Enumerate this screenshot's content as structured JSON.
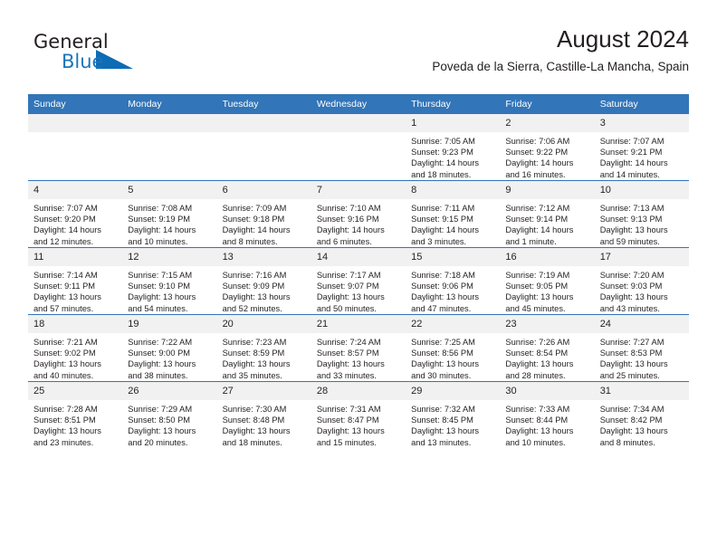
{
  "brand": {
    "name_part1": "General",
    "name_part2": "Blue",
    "triangle_color": "#0d6cb4"
  },
  "header": {
    "title": "August 2024",
    "subtitle": "Poveda de la Sierra, Castille-La Mancha, Spain"
  },
  "theme": {
    "header_blue": "#3275b8",
    "daynum_gray": "#f1f1f1",
    "text": "#231f20",
    "brand_blue": "#1b75bb"
  },
  "weekdays": [
    "Sunday",
    "Monday",
    "Tuesday",
    "Wednesday",
    "Thursday",
    "Friday",
    "Saturday"
  ],
  "labels": {
    "sunrise_prefix": "Sunrise:",
    "sunset_prefix": "Sunset:",
    "daylight_prefix": "Daylight:"
  },
  "weeks": [
    [
      {
        "day": "",
        "empty": true
      },
      {
        "day": "",
        "empty": true
      },
      {
        "day": "",
        "empty": true
      },
      {
        "day": "",
        "empty": true
      },
      {
        "day": "1",
        "sunrise": "Sunrise: 7:05 AM",
        "sunset": "Sunset: 9:23 PM",
        "daylight_line1": "Daylight: 14 hours",
        "daylight_line2": "and 18 minutes."
      },
      {
        "day": "2",
        "sunrise": "Sunrise: 7:06 AM",
        "sunset": "Sunset: 9:22 PM",
        "daylight_line1": "Daylight: 14 hours",
        "daylight_line2": "and 16 minutes."
      },
      {
        "day": "3",
        "sunrise": "Sunrise: 7:07 AM",
        "sunset": "Sunset: 9:21 PM",
        "daylight_line1": "Daylight: 14 hours",
        "daylight_line2": "and 14 minutes."
      }
    ],
    [
      {
        "day": "4",
        "sunrise": "Sunrise: 7:07 AM",
        "sunset": "Sunset: 9:20 PM",
        "daylight_line1": "Daylight: 14 hours",
        "daylight_line2": "and 12 minutes."
      },
      {
        "day": "5",
        "sunrise": "Sunrise: 7:08 AM",
        "sunset": "Sunset: 9:19 PM",
        "daylight_line1": "Daylight: 14 hours",
        "daylight_line2": "and 10 minutes."
      },
      {
        "day": "6",
        "sunrise": "Sunrise: 7:09 AM",
        "sunset": "Sunset: 9:18 PM",
        "daylight_line1": "Daylight: 14 hours",
        "daylight_line2": "and 8 minutes."
      },
      {
        "day": "7",
        "sunrise": "Sunrise: 7:10 AM",
        "sunset": "Sunset: 9:16 PM",
        "daylight_line1": "Daylight: 14 hours",
        "daylight_line2": "and 6 minutes."
      },
      {
        "day": "8",
        "sunrise": "Sunrise: 7:11 AM",
        "sunset": "Sunset: 9:15 PM",
        "daylight_line1": "Daylight: 14 hours",
        "daylight_line2": "and 3 minutes."
      },
      {
        "day": "9",
        "sunrise": "Sunrise: 7:12 AM",
        "sunset": "Sunset: 9:14 PM",
        "daylight_line1": "Daylight: 14 hours",
        "daylight_line2": "and 1 minute."
      },
      {
        "day": "10",
        "sunrise": "Sunrise: 7:13 AM",
        "sunset": "Sunset: 9:13 PM",
        "daylight_line1": "Daylight: 13 hours",
        "daylight_line2": "and 59 minutes."
      }
    ],
    [
      {
        "day": "11",
        "sunrise": "Sunrise: 7:14 AM",
        "sunset": "Sunset: 9:11 PM",
        "daylight_line1": "Daylight: 13 hours",
        "daylight_line2": "and 57 minutes."
      },
      {
        "day": "12",
        "sunrise": "Sunrise: 7:15 AM",
        "sunset": "Sunset: 9:10 PM",
        "daylight_line1": "Daylight: 13 hours",
        "daylight_line2": "and 54 minutes."
      },
      {
        "day": "13",
        "sunrise": "Sunrise: 7:16 AM",
        "sunset": "Sunset: 9:09 PM",
        "daylight_line1": "Daylight: 13 hours",
        "daylight_line2": "and 52 minutes."
      },
      {
        "day": "14",
        "sunrise": "Sunrise: 7:17 AM",
        "sunset": "Sunset: 9:07 PM",
        "daylight_line1": "Daylight: 13 hours",
        "daylight_line2": "and 50 minutes."
      },
      {
        "day": "15",
        "sunrise": "Sunrise: 7:18 AM",
        "sunset": "Sunset: 9:06 PM",
        "daylight_line1": "Daylight: 13 hours",
        "daylight_line2": "and 47 minutes."
      },
      {
        "day": "16",
        "sunrise": "Sunrise: 7:19 AM",
        "sunset": "Sunset: 9:05 PM",
        "daylight_line1": "Daylight: 13 hours",
        "daylight_line2": "and 45 minutes."
      },
      {
        "day": "17",
        "sunrise": "Sunrise: 7:20 AM",
        "sunset": "Sunset: 9:03 PM",
        "daylight_line1": "Daylight: 13 hours",
        "daylight_line2": "and 43 minutes."
      }
    ],
    [
      {
        "day": "18",
        "sunrise": "Sunrise: 7:21 AM",
        "sunset": "Sunset: 9:02 PM",
        "daylight_line1": "Daylight: 13 hours",
        "daylight_line2": "and 40 minutes."
      },
      {
        "day": "19",
        "sunrise": "Sunrise: 7:22 AM",
        "sunset": "Sunset: 9:00 PM",
        "daylight_line1": "Daylight: 13 hours",
        "daylight_line2": "and 38 minutes."
      },
      {
        "day": "20",
        "sunrise": "Sunrise: 7:23 AM",
        "sunset": "Sunset: 8:59 PM",
        "daylight_line1": "Daylight: 13 hours",
        "daylight_line2": "and 35 minutes."
      },
      {
        "day": "21",
        "sunrise": "Sunrise: 7:24 AM",
        "sunset": "Sunset: 8:57 PM",
        "daylight_line1": "Daylight: 13 hours",
        "daylight_line2": "and 33 minutes."
      },
      {
        "day": "22",
        "sunrise": "Sunrise: 7:25 AM",
        "sunset": "Sunset: 8:56 PM",
        "daylight_line1": "Daylight: 13 hours",
        "daylight_line2": "and 30 minutes."
      },
      {
        "day": "23",
        "sunrise": "Sunrise: 7:26 AM",
        "sunset": "Sunset: 8:54 PM",
        "daylight_line1": "Daylight: 13 hours",
        "daylight_line2": "and 28 minutes."
      },
      {
        "day": "24",
        "sunrise": "Sunrise: 7:27 AM",
        "sunset": "Sunset: 8:53 PM",
        "daylight_line1": "Daylight: 13 hours",
        "daylight_line2": "and 25 minutes."
      }
    ],
    [
      {
        "day": "25",
        "sunrise": "Sunrise: 7:28 AM",
        "sunset": "Sunset: 8:51 PM",
        "daylight_line1": "Daylight: 13 hours",
        "daylight_line2": "and 23 minutes."
      },
      {
        "day": "26",
        "sunrise": "Sunrise: 7:29 AM",
        "sunset": "Sunset: 8:50 PM",
        "daylight_line1": "Daylight: 13 hours",
        "daylight_line2": "and 20 minutes."
      },
      {
        "day": "27",
        "sunrise": "Sunrise: 7:30 AM",
        "sunset": "Sunset: 8:48 PM",
        "daylight_line1": "Daylight: 13 hours",
        "daylight_line2": "and 18 minutes."
      },
      {
        "day": "28",
        "sunrise": "Sunrise: 7:31 AM",
        "sunset": "Sunset: 8:47 PM",
        "daylight_line1": "Daylight: 13 hours",
        "daylight_line2": "and 15 minutes."
      },
      {
        "day": "29",
        "sunrise": "Sunrise: 7:32 AM",
        "sunset": "Sunset: 8:45 PM",
        "daylight_line1": "Daylight: 13 hours",
        "daylight_line2": "and 13 minutes."
      },
      {
        "day": "30",
        "sunrise": "Sunrise: 7:33 AM",
        "sunset": "Sunset: 8:44 PM",
        "daylight_line1": "Daylight: 13 hours",
        "daylight_line2": "and 10 minutes."
      },
      {
        "day": "31",
        "sunrise": "Sunrise: 7:34 AM",
        "sunset": "Sunset: 8:42 PM",
        "daylight_line1": "Daylight: 13 hours",
        "daylight_line2": "and 8 minutes."
      }
    ]
  ]
}
